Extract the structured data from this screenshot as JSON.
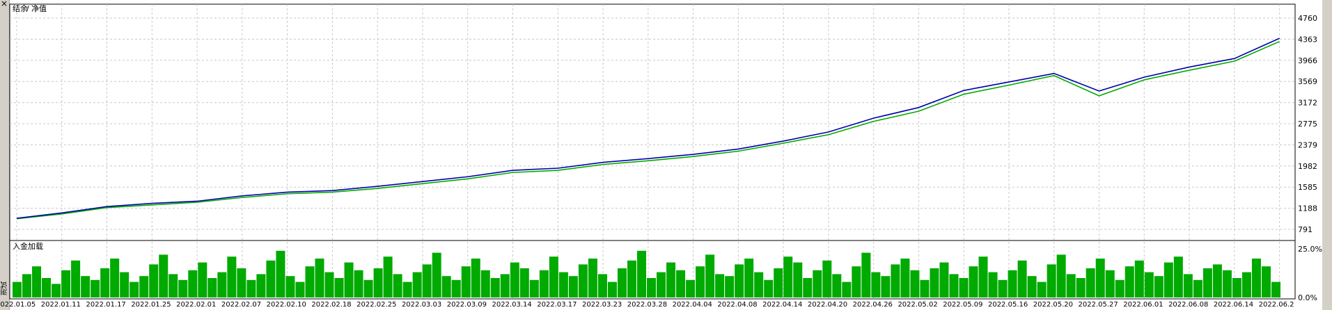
{
  "window": {
    "close_glyph": "×",
    "side_tab_label": "测试"
  },
  "colors": {
    "equity": "#0000aa",
    "balance": "#00aa00",
    "grid": "#c8c8c8",
    "load": "#00aa00"
  },
  "chart_data": [
    {
      "type": "line",
      "legend": [
        {
          "label": "结余",
          "color": "#0000aa"
        },
        {
          "label": "净值",
          "color": "#00aa00"
        }
      ],
      "legend_separator": "/",
      "legend_placement": "top-left",
      "ylim": [
        791,
        4760
      ],
      "y_ticks": [
        "4760",
        "4363",
        "3966",
        "3569",
        "3172",
        "2775",
        "2379",
        "1982",
        "1585",
        "1188",
        "791"
      ],
      "x_ticks": [
        "2022.01.05",
        "2022.01.11",
        "2022.01.17",
        "2022.01.25",
        "2022.02.01",
        "2022.02.07",
        "2022.02.10",
        "2022.02.18",
        "2022.02.25",
        "2022.03.03",
        "2022.03.09",
        "2022.03.14",
        "2022.03.17",
        "2022.03.23",
        "2022.03.28",
        "2022.04.04",
        "2022.04.08",
        "2022.04.14",
        "2022.04.20",
        "2022.04.26",
        "2022.05.02",
        "2022.05.09",
        "2022.05.16",
        "2022.05.20",
        "2022.05.27",
        "2022.06.01",
        "2022.06.08",
        "2022.06.14",
        "2022.06.2"
      ],
      "grid": true,
      "series": [
        {
          "name": "结余",
          "x": [
            "2022.01.05",
            "2022.01.11",
            "2022.01.17",
            "2022.01.25",
            "2022.02.01",
            "2022.02.07",
            "2022.02.10",
            "2022.02.18",
            "2022.02.25",
            "2022.03.03",
            "2022.03.09",
            "2022.03.14",
            "2022.03.17",
            "2022.03.23",
            "2022.03.28",
            "2022.04.04",
            "2022.04.08",
            "2022.04.14",
            "2022.04.20",
            "2022.04.26",
            "2022.05.02",
            "2022.05.09",
            "2022.05.16",
            "2022.05.20",
            "2022.05.27",
            "2022.06.01",
            "2022.06.08",
            "2022.06.14",
            "2022.06.2"
          ],
          "values": [
            1000,
            1100,
            1220,
            1280,
            1320,
            1420,
            1490,
            1520,
            1600,
            1690,
            1780,
            1900,
            1940,
            2050,
            2120,
            2200,
            2300,
            2450,
            2620,
            2880,
            3080,
            3400,
            3560,
            3720,
            3390,
            3650,
            3840,
            4000,
            4380
          ]
        },
        {
          "name": "净值",
          "x": [
            "2022.01.05",
            "2022.01.11",
            "2022.01.17",
            "2022.01.25",
            "2022.02.01",
            "2022.02.07",
            "2022.02.10",
            "2022.02.18",
            "2022.02.25",
            "2022.03.03",
            "2022.03.09",
            "2022.03.14",
            "2022.03.17",
            "2022.03.23",
            "2022.03.28",
            "2022.04.04",
            "2022.04.08",
            "2022.04.14",
            "2022.04.20",
            "2022.04.26",
            "2022.05.02",
            "2022.05.09",
            "2022.05.16",
            "2022.05.20",
            "2022.05.27",
            "2022.06.01",
            "2022.06.08",
            "2022.06.14",
            "2022.06.2"
          ],
          "values": [
            990,
            1080,
            1200,
            1250,
            1300,
            1390,
            1460,
            1490,
            1560,
            1650,
            1740,
            1860,
            1900,
            2010,
            2080,
            2160,
            2260,
            2410,
            2570,
            2820,
            3010,
            3330,
            3500,
            3680,
            3300,
            3600,
            3780,
            3950,
            4320
          ]
        }
      ]
    },
    {
      "type": "bar",
      "title": "入金加载",
      "ylim": [
        0,
        25
      ],
      "y_ticks": [
        "25.0%",
        "0.0%"
      ],
      "series": [
        {
          "name": "入金加载",
          "values": [
            8,
            12,
            16,
            10,
            7,
            14,
            19,
            11,
            9,
            15,
            20,
            13,
            8,
            11,
            17,
            22,
            12,
            9,
            14,
            18,
            10,
            13,
            21,
            15,
            9,
            12,
            19,
            24,
            11,
            8,
            16,
            20,
            13,
            10,
            18,
            14,
            9,
            15,
            21,
            12,
            8,
            13,
            17,
            23,
            11,
            9,
            16,
            20,
            14,
            10,
            12,
            18,
            15,
            9,
            14,
            21,
            13,
            11,
            17,
            20,
            12,
            8,
            15,
            19,
            24,
            10,
            13,
            18,
            14,
            9,
            16,
            22,
            12,
            11,
            17,
            20,
            13,
            9,
            15,
            21,
            18,
            10,
            14,
            19,
            12,
            8,
            16,
            23,
            13,
            11,
            17,
            20,
            14,
            9,
            15,
            18,
            12,
            10,
            16,
            21,
            13,
            9,
            14,
            19,
            11,
            8,
            17,
            22,
            12,
            10,
            15,
            20,
            14,
            9,
            16,
            19,
            13,
            11,
            18,
            21,
            12,
            9,
            15,
            17,
            14,
            10,
            13,
            20,
            16,
            8
          ]
        }
      ]
    }
  ]
}
